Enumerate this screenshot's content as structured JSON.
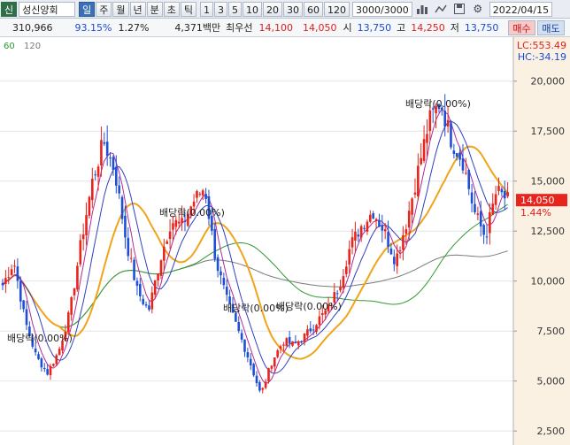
{
  "toolbar": {
    "tag": "신",
    "stock_name": "성신양회",
    "periods": [
      "일",
      "주",
      "월",
      "년",
      "분",
      "초",
      "틱"
    ],
    "active_period": "일",
    "intervals": [
      "1",
      "3",
      "5",
      "10",
      "20",
      "30",
      "60",
      "120"
    ],
    "count": "3000/3000",
    "date": "2022/04/15",
    "icons": [
      "bar-chart-icon",
      "line-tool-icon",
      "save-icon",
      "gear-icon"
    ]
  },
  "info": {
    "volume": "310,966",
    "volume_ratio": "93.15%",
    "change_rate": "1.27%",
    "amount": "4,371백만",
    "rank": "최우선",
    "bid1": "14,100",
    "bid2": "14,050",
    "open_label": "시",
    "open": "13,750",
    "high_label": "고",
    "high": "14,250",
    "low_label": "저",
    "low": "13,750"
  },
  "trade": {
    "buy": "매수",
    "sell": "매도"
  },
  "chart_data": {
    "type": "candlestick",
    "legend": [
      "60",
      "120"
    ],
    "y_axis": {
      "ticks": [
        "20,000",
        "17,500",
        "15,000",
        "12,500",
        "10,000",
        "7,500",
        "5,000",
        "2,500"
      ],
      "ylim": [
        1800,
        22200
      ]
    },
    "lc_label": "LC:553.49",
    "hc_label": "HC:-34.19",
    "current_price": "14,050",
    "current_change": "1.44%",
    "annotations": [
      "배당락(0.00%)",
      "배당락(0.00%)",
      "배당락(0.00%)",
      "배당락(0.00%)",
      "배당락(0.00%)"
    ],
    "price_path": [
      9800,
      11000,
      8000,
      6200,
      5400,
      6500,
      8500,
      12000,
      15000,
      17000,
      15500,
      12000,
      9500,
      8500,
      11000,
      13000,
      12800,
      14000,
      14700,
      11000,
      9000,
      7500,
      6000,
      4300,
      6000,
      7000,
      6800,
      7300,
      8000,
      8600,
      9800,
      11800,
      12800,
      13500,
      12500,
      11000,
      13000,
      15500,
      18000,
      19000,
      17000,
      16000,
      13500,
      12200,
      14500,
      14050
    ],
    "colors": {
      "up": "#e8241c",
      "down": "#1f4fd6",
      "ma5": "#b02a9a",
      "ma10": "#3040c0",
      "ma20": "#f0a41a",
      "ma60": "#2e9a2e",
      "ma120": "#7a7a7a",
      "price_tag": "#e8241c"
    }
  }
}
